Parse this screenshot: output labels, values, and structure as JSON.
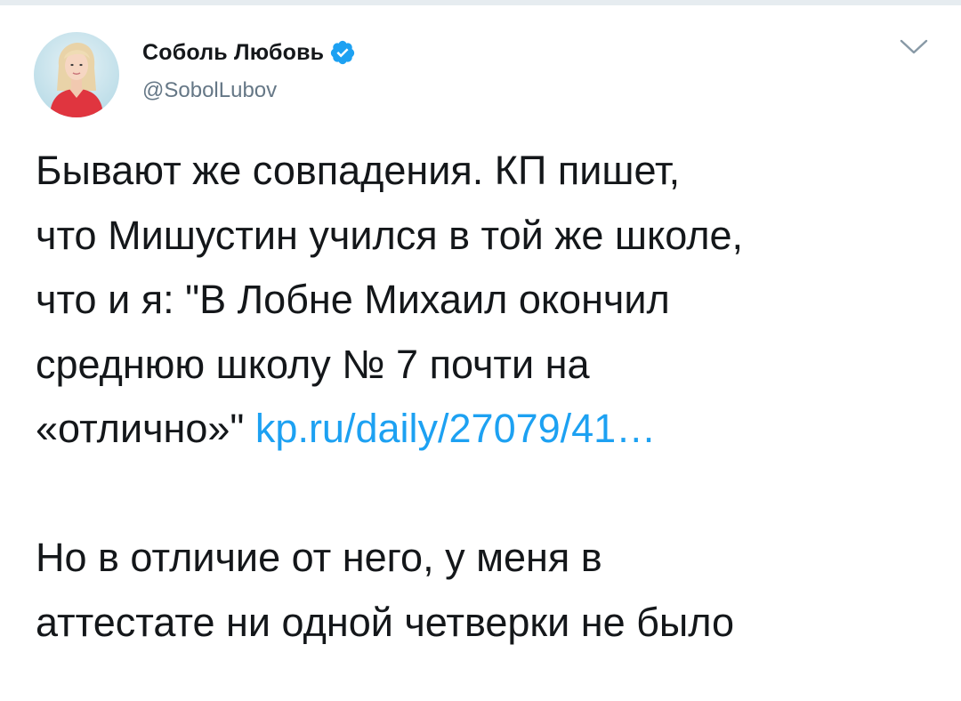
{
  "app": {
    "accent_color": "#1da1f2",
    "text_color": "#14171a",
    "secondary_color": "#657786"
  },
  "author": {
    "display_name": "Соболь Любовь",
    "handle": "@SobolLubov",
    "verified": true,
    "avatar_icon": "avatar-photo",
    "verified_icon": "verified-badge-icon",
    "menu_icon": "chevron-down-icon"
  },
  "tweet": {
    "lines": [
      "Бывают же совпадения. КП пишет,",
      "что Мишустин учился в той же школе,",
      "что и я: \"В Лобне Михаил окончил",
      "среднюю школу № 7 почти на"
    ],
    "line5_text": "«отлично»\"",
    "link_text": "kp.ru/daily/27079/41…",
    "para2_lines": [
      "Но в отличие от него, у меня в",
      "аттестате ни одной четверки не было"
    ]
  }
}
